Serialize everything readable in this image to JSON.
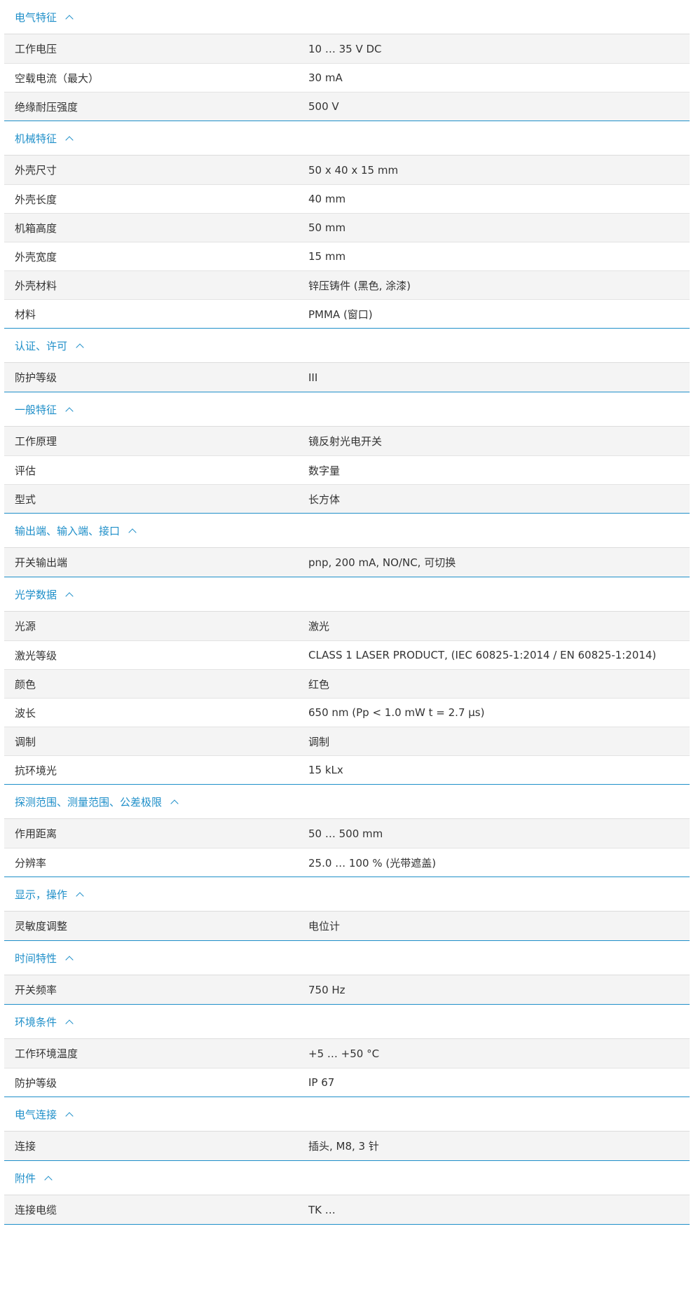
{
  "accent_color": "#1f8fc9",
  "icons": {
    "section_toggle": "chevron-up-icon"
  },
  "sections": [
    {
      "title": "电气特征",
      "rows": [
        {
          "label": "工作电压",
          "value": "10 … 35 V DC"
        },
        {
          "label": "空载电流（最大）",
          "value": "30 mA"
        },
        {
          "label": "绝缘耐压强度",
          "value": "500 V"
        }
      ]
    },
    {
      "title": "机械特征",
      "rows": [
        {
          "label": "外壳尺寸",
          "value": "50 x 40 x 15 mm"
        },
        {
          "label": "外壳长度",
          "value": "40 mm"
        },
        {
          "label": "机箱高度",
          "value": "50 mm"
        },
        {
          "label": "外壳宽度",
          "value": "15 mm"
        },
        {
          "label": "外壳材料",
          "value": "锌压铸件 (黑色, 涂漆)"
        },
        {
          "label": "材料",
          "value": "PMMA (窗口)"
        }
      ]
    },
    {
      "title": "认证、许可",
      "rows": [
        {
          "label": "防护等级",
          "value": "III"
        }
      ]
    },
    {
      "title": "一般特征",
      "rows": [
        {
          "label": "工作原理",
          "value": "镜反射光电开关"
        },
        {
          "label": "评估",
          "value": "数字量"
        },
        {
          "label": "型式",
          "value": "长方体"
        }
      ]
    },
    {
      "title": "输出端、输入端、接口",
      "rows": [
        {
          "label": "开关输出端",
          "value": "pnp, 200 mA, NO/NC, 可切换"
        }
      ]
    },
    {
      "title": "光学数据",
      "rows": [
        {
          "label": "光源",
          "value": "激光"
        },
        {
          "label": "激光等级",
          "value": "CLASS 1 LASER PRODUCT, (IEC 60825-1:2014 / EN 60825-1:2014)"
        },
        {
          "label": "颜色",
          "value": "红色"
        },
        {
          "label": "波长",
          "value": "650 nm (Pp < 1.0 mW t = 2.7 µs)"
        },
        {
          "label": "调制",
          "value": "调制"
        },
        {
          "label": "抗环境光",
          "value": "15 kLx"
        }
      ]
    },
    {
      "title": "探测范围、测量范围、公差极限",
      "rows": [
        {
          "label": "作用距离",
          "value": "50 … 500 mm"
        },
        {
          "label": "分辨率",
          "value": "25.0 … 100 % (光带遮盖)"
        }
      ]
    },
    {
      "title": "显示，操作",
      "rows": [
        {
          "label": "灵敏度调整",
          "value": "电位计"
        }
      ]
    },
    {
      "title": "时间特性",
      "rows": [
        {
          "label": "开关频率",
          "value": "750 Hz"
        }
      ]
    },
    {
      "title": "环境条件",
      "rows": [
        {
          "label": "工作环境温度",
          "value": "+5 … +50 °C"
        },
        {
          "label": "防护等级",
          "value": "IP 67"
        }
      ]
    },
    {
      "title": "电气连接",
      "rows": [
        {
          "label": "连接",
          "value": "插头, M8, 3 针"
        }
      ]
    },
    {
      "title": "附件",
      "rows": [
        {
          "label": "连接电缆",
          "value": "TK …"
        }
      ]
    }
  ]
}
